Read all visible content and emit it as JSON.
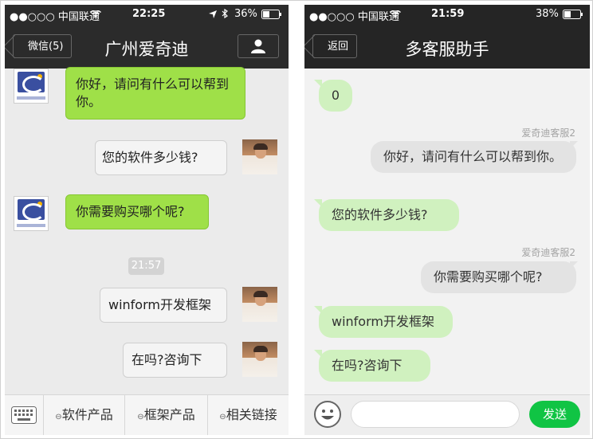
{
  "left_phone": {
    "status_bar": {
      "carrier": "●●○○○ 中国联通",
      "time": "22:25",
      "battery": "36%"
    },
    "nav": {
      "back_label": "微信(5)",
      "title": "广州爱奇迪"
    },
    "messages": [
      {
        "side": "left",
        "text": "你好，请问有什么可以帮到你。"
      },
      {
        "side": "right",
        "text": "您的软件多少钱?"
      },
      {
        "side": "left",
        "text": "你需要购买哪个呢?"
      },
      {
        "side": "right",
        "text": "winform开发框架"
      },
      {
        "side": "right",
        "text": "在吗?咨询下"
      }
    ],
    "timestamp": "21:57",
    "toolbar": [
      "软件产品",
      "框架产品",
      "相关链接"
    ]
  },
  "right_phone": {
    "status_bar": {
      "carrier": "●●○○○ 中国联通",
      "time": "21:59",
      "battery": "38%"
    },
    "nav": {
      "back_label": "返回",
      "title": "多客服助手"
    },
    "messages": [
      {
        "side": "left",
        "text": "0"
      },
      {
        "side": "right",
        "sender": "爱奇迪客服2",
        "text": "你好，请问有什么可以帮到你。"
      },
      {
        "side": "left",
        "text": "您的软件多少钱?"
      },
      {
        "side": "right",
        "sender": "爱奇迪客服2",
        "text": "你需要购买哪个呢?"
      },
      {
        "side": "left",
        "text": "winform开发框架"
      },
      {
        "side": "left",
        "text": "在吗?咨询下"
      }
    ],
    "send_label": "发送"
  },
  "colors": {
    "nav_dark": "#2b2b2b",
    "bubble_green": "#9fe048",
    "bubble_light_green": "#d0f1bf",
    "bubble_gray": "#e3e3e3",
    "send_green": "#10c444"
  },
  "icons": [
    "wifi-icon",
    "location-icon",
    "bluetooth-icon",
    "battery-icon",
    "profile-icon",
    "keyboard-icon",
    "smiley-icon"
  ]
}
